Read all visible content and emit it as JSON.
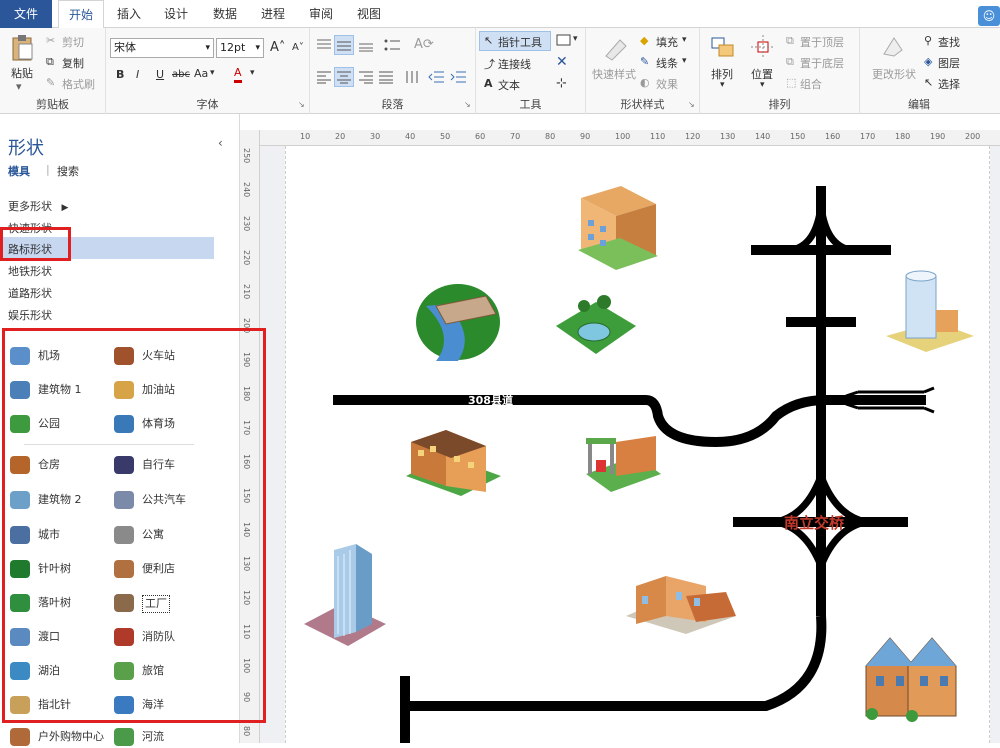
{
  "tabs": [
    "文件",
    "开始",
    "插入",
    "设计",
    "数据",
    "进程",
    "审阅",
    "视图"
  ],
  "clipboard": {
    "paste": "粘贴",
    "cut": "剪切",
    "copy": "复制",
    "format_painter": "格式刷",
    "label": "剪贴板"
  },
  "font": {
    "name": "宋体",
    "size": "12pt",
    "bold": "B",
    "italic": "I",
    "underline": "U",
    "strike": "abc",
    "case": "Aa",
    "color": "A",
    "label": "字体"
  },
  "paragraph": {
    "label": "段落"
  },
  "tools": {
    "pointer": "指针工具",
    "connector": "连接线",
    "text": "文本",
    "label": "工具"
  },
  "shape_style": {
    "quick": "快速样式",
    "fill": "填充",
    "line": "线条",
    "effect": "效果",
    "label": "形状样式"
  },
  "arrange": {
    "arrange": "排列",
    "position": "位置",
    "bring_front": "置于顶层",
    "send_back": "置于底层",
    "group": "组合",
    "label": "排列"
  },
  "editing": {
    "change_shape": "更改形状",
    "find": "查找",
    "layers": "图层",
    "select": "选择",
    "label": "编辑"
  },
  "panel": {
    "title": "形状",
    "tab_stencils": "模具",
    "tab_search": "搜索",
    "more": "更多形状",
    "categories": [
      "快速形状",
      "路标形状",
      "地铁形状",
      "道路形状",
      "娱乐形状"
    ]
  },
  "shapes": [
    [
      "机场",
      "火车站"
    ],
    [
      "建筑物 1",
      "加油站"
    ],
    [
      "公园",
      "体育场"
    ],
    [
      "仓房",
      "自行车"
    ],
    [
      "建筑物 2",
      "公共汽车"
    ],
    [
      "城市",
      "公寓"
    ],
    [
      "针叶树",
      "便利店"
    ],
    [
      "落叶树",
      "工厂"
    ],
    [
      "渡口",
      "消防队"
    ],
    [
      "湖泊",
      "旅馆"
    ],
    [
      "指北针",
      "海洋"
    ],
    [
      "户外购物中心",
      "河流"
    ]
  ],
  "ruler_h": [
    "10",
    "20",
    "30",
    "40",
    "50",
    "60",
    "70",
    "80",
    "90",
    "100",
    "110",
    "120",
    "130",
    "140",
    "150",
    "160",
    "170",
    "180",
    "190",
    "200"
  ],
  "ruler_v": [
    "250",
    "240",
    "230",
    "220",
    "210",
    "200",
    "190",
    "180",
    "170",
    "160",
    "150",
    "140",
    "130",
    "120",
    "110",
    "100",
    "90",
    "80"
  ],
  "map": {
    "road_label": "308县道",
    "interchange_label": "南立交桥"
  },
  "colors": {
    "accent": "#2b579a",
    "highlight": "#e02020",
    "road": "#000000"
  }
}
